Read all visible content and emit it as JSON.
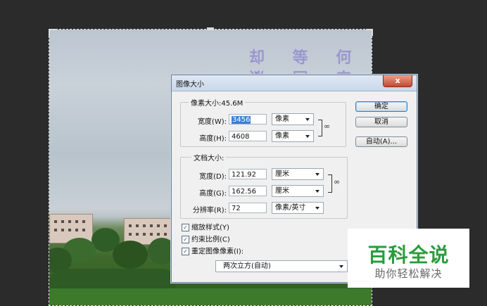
{
  "dialog": {
    "title": "图像大小",
    "close_label": "x",
    "pixel_dimensions": {
      "legend": "像素大小:45.6M",
      "width_label": "宽度(W):",
      "width_value": "3456",
      "width_unit": "像素",
      "height_label": "高度(H):",
      "height_value": "4608",
      "height_unit": "像素"
    },
    "document_size": {
      "legend": "文档大小:",
      "width_label": "宽度(D):",
      "width_value": "121.92",
      "width_unit": "厘米",
      "height_label": "高度(G):",
      "height_value": "162.56",
      "height_unit": "厘米",
      "resolution_label": "分辨率(R):",
      "resolution_value": "72",
      "resolution_unit": "像素/英寸"
    },
    "buttons": {
      "ok": "确定",
      "cancel": "取消",
      "auto": "自动(A)..."
    },
    "checkboxes": {
      "scale_styles": "缩放样式(Y)",
      "constrain_proportions": "约束比例(C)",
      "resample": "重定图像像素(I):"
    },
    "resample_method": "两次立方(自动)"
  },
  "watermark": {
    "title": "百科全说",
    "subtitle": "助你轻松解决"
  },
  "photo_overlay_text": {
    "row1": "却 等 何 人",
    "row2": "迷 同 来 生"
  },
  "colors": {
    "brand_green": "#2a9d3c",
    "dialog_bg": "#f0f0f0",
    "workspace_bg": "#2b2b2b"
  }
}
